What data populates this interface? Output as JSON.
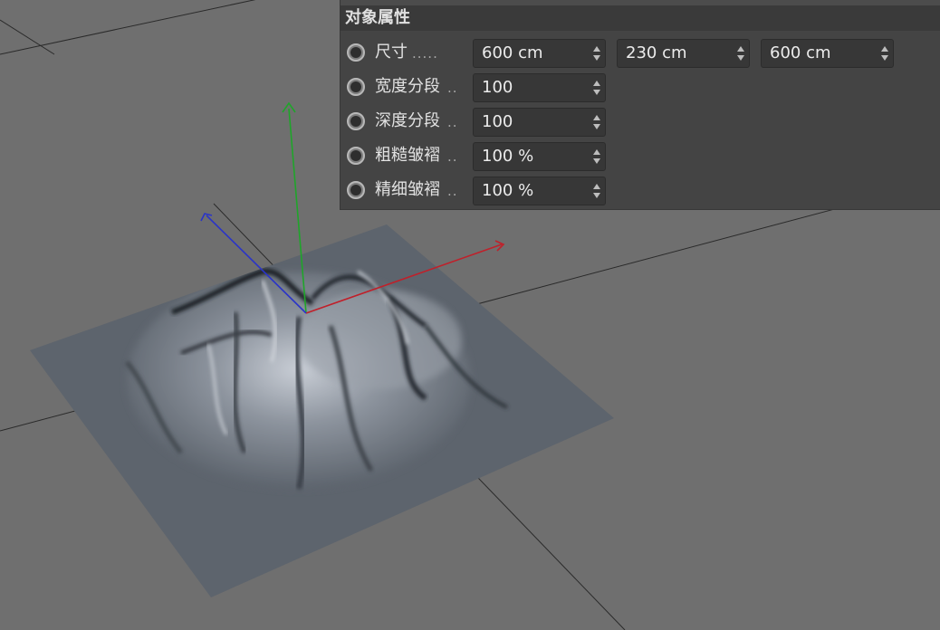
{
  "panel": {
    "title": "对象属性",
    "rows": [
      {
        "label": "尺寸",
        "dots": ".....",
        "values": [
          "600 cm",
          "230 cm",
          "600 cm"
        ]
      },
      {
        "label": "宽度分段",
        "dots": "..",
        "values": [
          "100"
        ]
      },
      {
        "label": "深度分段",
        "dots": "..",
        "values": [
          "100"
        ]
      },
      {
        "label": "粗糙皱褶",
        "dots": "..",
        "values": [
          "100 %"
        ]
      },
      {
        "label": "精细皱褶",
        "dots": "..",
        "values": [
          "100 %"
        ]
      }
    ]
  },
  "viewport": {
    "object": "landscape-terrain",
    "axes": {
      "x": "#c0202a",
      "y": "#1fa52a",
      "z": "#2a34c8"
    },
    "colors": {
      "background": "#6f6f6f",
      "terrain": "#5d646d",
      "grid_line": "#2a2a2a"
    }
  }
}
